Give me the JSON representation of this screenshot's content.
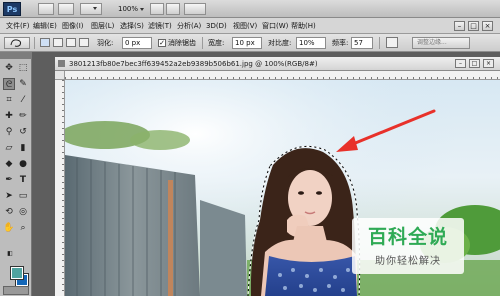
{
  "app": {
    "logo": "Ps",
    "zoom": "100%"
  },
  "menu": [
    {
      "label": "文件(F)"
    },
    {
      "label": "编辑(E)"
    },
    {
      "label": "图像(I)"
    },
    {
      "label": "图层(L)"
    },
    {
      "label": "选择(S)"
    },
    {
      "label": "滤镜(T)"
    },
    {
      "label": "分析(A)"
    },
    {
      "label": "3D(D)"
    },
    {
      "label": "视图(V)"
    },
    {
      "label": "窗口(W)"
    },
    {
      "label": "帮助(H)"
    }
  ],
  "options": {
    "feather_label": "羽化:",
    "feather_value": "0 px",
    "antialias_label": "消除锯齿",
    "antialias_checked": true,
    "width_label": "宽度:",
    "width_value": "10 px",
    "contrast_label": "对比度:",
    "contrast_value": "10%",
    "frequency_label": "频率:",
    "frequency_value": "57",
    "refine_edge_label": "调整边缘..."
  },
  "document": {
    "tab_title": "3801213fb80e7bec3ff639452a2eb9389b506b61.jpg @ 100%(RGB/8#)"
  },
  "colors": {
    "foreground": "#4fa3a0",
    "background": "#1467b8",
    "annotation_arrow": "#e8312a"
  },
  "watermark": {
    "title": "百科全说",
    "subtitle": "助你轻松解决"
  }
}
